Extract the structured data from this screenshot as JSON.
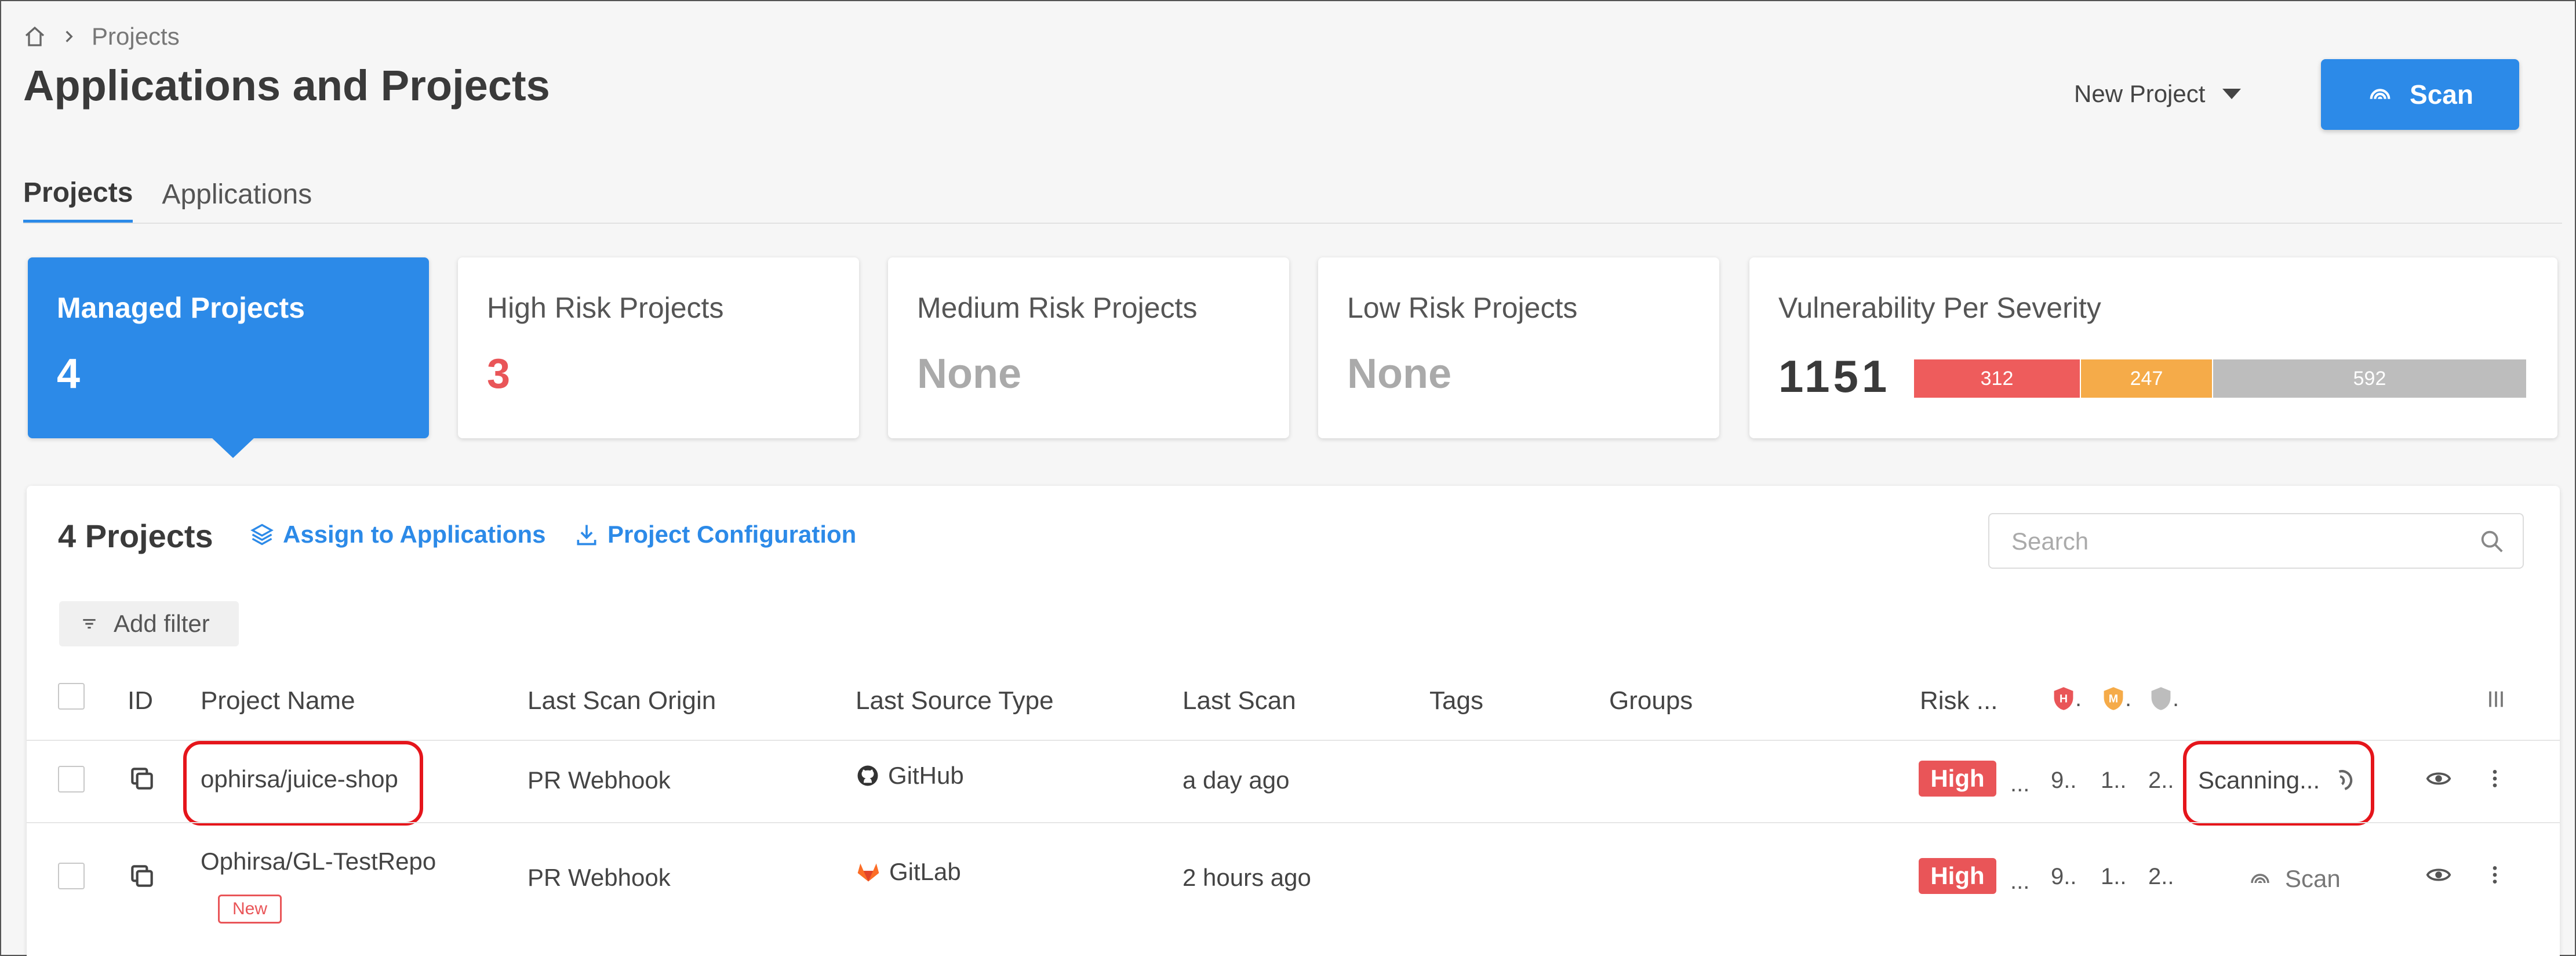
{
  "breadcrumb": {
    "current": "Projects"
  },
  "page": {
    "title": "Applications and Projects"
  },
  "header": {
    "new_project_label": "New Project",
    "scan_label": "Scan"
  },
  "tabs": [
    {
      "label": "Projects",
      "active": true
    },
    {
      "label": "Applications",
      "active": false
    }
  ],
  "summary": {
    "managed": {
      "title": "Managed Projects",
      "value": "4"
    },
    "high": {
      "title": "High Risk Projects",
      "value": "3",
      "color": "#e95558"
    },
    "medium": {
      "title": "Medium Risk Projects",
      "value": "None"
    },
    "low": {
      "title": "Low Risk Projects",
      "value": "None"
    },
    "vulnerability": {
      "title": "Vulnerability Per Severity",
      "total": "1151",
      "segments": [
        {
          "label": "312",
          "color": "#ee5c5c"
        },
        {
          "label": "247",
          "color": "#f5ab49"
        },
        {
          "label": "592",
          "color": "#bdbdbd"
        }
      ]
    }
  },
  "toolbar": {
    "count_label": "4 Projects",
    "assign_label": "Assign to Applications",
    "config_label": "Project Configuration",
    "search_placeholder": "Search",
    "add_filter_label": "Add filter"
  },
  "table": {
    "columns": {
      "id": "ID",
      "project_name": "Project Name",
      "last_scan_origin": "Last Scan Origin",
      "last_source_type": "Last Source Type",
      "last_scan": "Last Scan",
      "tags": "Tags",
      "groups": "Groups",
      "risk": "Risk ...",
      "sev_high_dot": ".",
      "sev_medium_dot": ".",
      "sev_low_dot": "."
    },
    "rows": [
      {
        "project_name": "ophirsa/juice-shop",
        "last_scan_origin": "PR Webhook",
        "last_source_type": "GitHub",
        "last_scan": "a day ago",
        "risk": "High",
        "risk_more": "...",
        "sev_high": "9..",
        "sev_medium": "1..",
        "sev_low": "2..",
        "status": "Scanning..."
      },
      {
        "project_name": "Ophirsa/GL-TestRepo",
        "badge": "New",
        "last_scan_origin": "PR Webhook",
        "last_source_type": "GitLab",
        "last_scan": "2 hours ago",
        "risk": "High",
        "risk_more": "...",
        "sev_high": "9..",
        "sev_medium": "1..",
        "sev_low": "2..",
        "action": "Scan"
      }
    ]
  },
  "icons": {
    "severity_high": "H",
    "severity_medium": "M",
    "colors": {
      "accent": "#2c8ae8",
      "high": "#e95558",
      "medium": "#f5ab49",
      "low": "#bdbdbd",
      "highlight": "#e5151b"
    }
  }
}
